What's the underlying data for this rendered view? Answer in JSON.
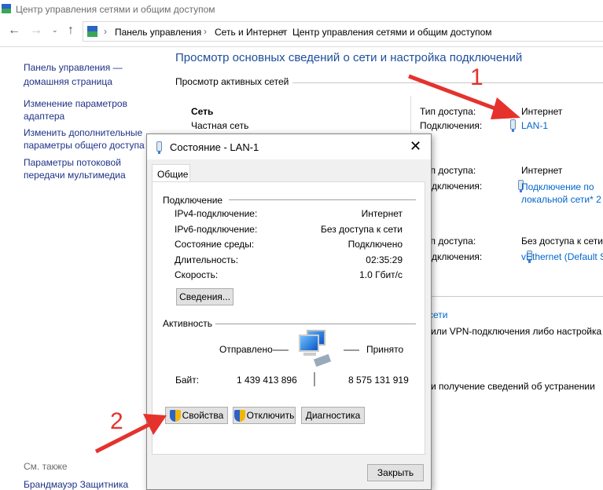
{
  "window": {
    "title": "Центр управления сетями и общим доступом"
  },
  "nav": {
    "breadcrumb": [
      "Панель управления",
      "Сеть и Интернет",
      "Центр управления сетями и общим доступом"
    ]
  },
  "sidebar": {
    "items": [
      "Панель управления —",
      "домашняя страница",
      "Изменение параметров",
      "адаптера",
      "Изменить дополнительные",
      "параметры общего доступа",
      "Параметры потоковой",
      "передачи мультимедиа"
    ],
    "see_also": "См. также",
    "firewall": "Брандмауэр Защитника"
  },
  "main": {
    "title": "Просмотр основных сведений о сети и настройка подключений",
    "active_networks": "Просмотр активных сетей",
    "network_name": "Сеть",
    "network_type": "Частная сеть",
    "access_label": "Тип доступа:",
    "conn_label": "Подключения:",
    "networks": [
      {
        "access": "Интернет",
        "conn": "LAN-1"
      },
      {
        "access": "Интернет",
        "conn1": "Подключение по",
        "conn2": "локальной сети* 2"
      },
      {
        "access": "Без доступа к сети",
        "conn": "vEthernet (Default S"
      }
    ],
    "bottom_link": "сети",
    "bottom_text1": "или VPN-подключения либо настройка",
    "bottom_text2": "и получение сведений об устранении"
  },
  "dialog": {
    "title": "Состояние - LAN-1",
    "tab": "Общие",
    "connection_group": "Подключение",
    "rows": [
      {
        "label": "IPv4-подключение:",
        "value": "Интернет"
      },
      {
        "label": "IPv6-подключение:",
        "value": "Без доступа к сети"
      },
      {
        "label": "Состояние среды:",
        "value": "Подключено"
      },
      {
        "label": "Длительность:",
        "value": "02:35:29"
      },
      {
        "label": "Скорость:",
        "value": "1.0 Гбит/с"
      }
    ],
    "details_btn": "Сведения...",
    "activity_group": "Активность",
    "sent": "Отправлено",
    "received": "Принято",
    "bytes_label": "Байт:",
    "bytes_sent": "1 439 413 896",
    "bytes_received": "8 575 131 919",
    "properties_btn": "Свойства",
    "disable_btn": "Отключить",
    "diagnose_btn": "Диагностика",
    "close_btn": "Закрыть"
  },
  "annotations": {
    "one": "1",
    "two": "2"
  }
}
